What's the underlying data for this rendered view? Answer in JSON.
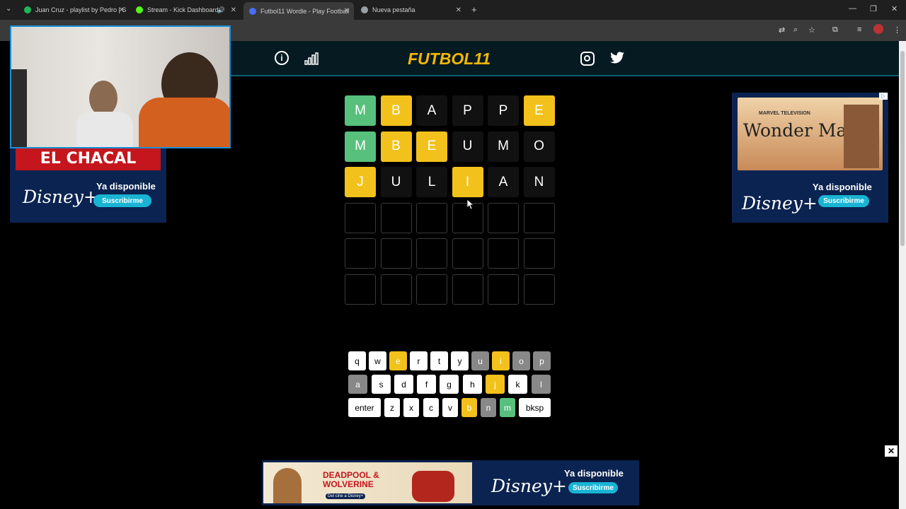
{
  "browser": {
    "tabs": [
      {
        "label": "Juan Cruz - playlist by Pedro | S",
        "color": "#1db954"
      },
      {
        "label": "Stream - Kick Dashboard",
        "color": "#53fc18"
      },
      {
        "label": "Futbol11 Wordle - Play Football",
        "color": "#4a6cf7"
      },
      {
        "label": "Nueva pestaña",
        "color": "#9aa0a6"
      }
    ],
    "new_tab": "+",
    "window_controls": [
      "—",
      "❐",
      "✕"
    ],
    "toolbar_icons": [
      "translate-icon",
      "zoom-icon",
      "star-icon",
      "extensions-icon",
      "media-icon",
      "profile-icon",
      "menu-icon"
    ]
  },
  "header": {
    "logo": "FUTBOL11",
    "left_icons": [
      "info-icon",
      "stats-icon"
    ],
    "right_icons": [
      "instagram-icon",
      "twitter-icon"
    ]
  },
  "grid": {
    "rows": [
      [
        {
          "l": "M",
          "s": "green"
        },
        {
          "l": "B",
          "s": "yellow"
        },
        {
          "l": "A",
          "s": "dark"
        },
        {
          "l": "P",
          "s": "dark"
        },
        {
          "l": "P",
          "s": "dark"
        },
        {
          "l": "E",
          "s": "yellow"
        }
      ],
      [
        {
          "l": "M",
          "s": "green"
        },
        {
          "l": "B",
          "s": "yellow"
        },
        {
          "l": "E",
          "s": "yellow"
        },
        {
          "l": "U",
          "s": "dark"
        },
        {
          "l": "M",
          "s": "dark"
        },
        {
          "l": "O",
          "s": "dark"
        }
      ],
      [
        {
          "l": "J",
          "s": "yellow"
        },
        {
          "l": "U",
          "s": "dark"
        },
        {
          "l": "L",
          "s": "dark"
        },
        {
          "l": "I",
          "s": "yellow"
        },
        {
          "l": "A",
          "s": "dark"
        },
        {
          "l": "N",
          "s": "dark"
        }
      ],
      [
        {
          "l": "",
          "s": "empty"
        },
        {
          "l": "",
          "s": "empty"
        },
        {
          "l": "",
          "s": "empty"
        },
        {
          "l": "",
          "s": "empty"
        },
        {
          "l": "",
          "s": "empty"
        },
        {
          "l": "",
          "s": "empty"
        }
      ],
      [
        {
          "l": "",
          "s": "empty"
        },
        {
          "l": "",
          "s": "empty"
        },
        {
          "l": "",
          "s": "empty"
        },
        {
          "l": "",
          "s": "empty"
        },
        {
          "l": "",
          "s": "empty"
        },
        {
          "l": "",
          "s": "empty"
        }
      ],
      [
        {
          "l": "",
          "s": "empty"
        },
        {
          "l": "",
          "s": "empty"
        },
        {
          "l": "",
          "s": "empty"
        },
        {
          "l": "",
          "s": "empty"
        },
        {
          "l": "",
          "s": "empty"
        },
        {
          "l": "",
          "s": "empty"
        }
      ]
    ]
  },
  "keyboard": {
    "rows": [
      [
        {
          "k": "q",
          "s": ""
        },
        {
          "k": "w",
          "s": ""
        },
        {
          "k": "e",
          "s": "yellow"
        },
        {
          "k": "r",
          "s": ""
        },
        {
          "k": "t",
          "s": ""
        },
        {
          "k": "y",
          "s": ""
        },
        {
          "k": "u",
          "s": "gray"
        },
        {
          "k": "i",
          "s": "yellow"
        },
        {
          "k": "o",
          "s": "gray"
        },
        {
          "k": "p",
          "s": "gray"
        }
      ],
      [
        {
          "k": "a",
          "s": "gray"
        },
        {
          "k": "s",
          "s": ""
        },
        {
          "k": "d",
          "s": ""
        },
        {
          "k": "f",
          "s": ""
        },
        {
          "k": "g",
          "s": ""
        },
        {
          "k": "h",
          "s": ""
        },
        {
          "k": "j",
          "s": "yellow"
        },
        {
          "k": "k",
          "s": ""
        },
        {
          "k": "l",
          "s": "gray"
        }
      ],
      [
        {
          "k": "enter",
          "s": ""
        },
        {
          "k": "z",
          "s": ""
        },
        {
          "k": "x",
          "s": ""
        },
        {
          "k": "c",
          "s": ""
        },
        {
          "k": "v",
          "s": ""
        },
        {
          "k": "b",
          "s": "yellow"
        },
        {
          "k": "n",
          "s": "gray"
        },
        {
          "k": "m",
          "s": "green"
        },
        {
          "k": "bksp",
          "s": ""
        }
      ]
    ]
  },
  "ads": {
    "left": {
      "banner": "EL CHACAL",
      "available": "Ya disponible",
      "brand": "Disney+",
      "cta": "Suscribirme"
    },
    "right": {
      "banner_top": "MARVEL TELEVISION",
      "banner": "Wonder Man",
      "available": "Ya disponible",
      "brand": "Disney+",
      "cta": "Suscribirme"
    },
    "bottom": {
      "banner": "DEADPOOL & WOLVERINE",
      "sub": "Del cine a Disney+",
      "available": "Ya disponible",
      "brand": "Disney+",
      "cta": "Suscribirme"
    },
    "close": "✕"
  }
}
